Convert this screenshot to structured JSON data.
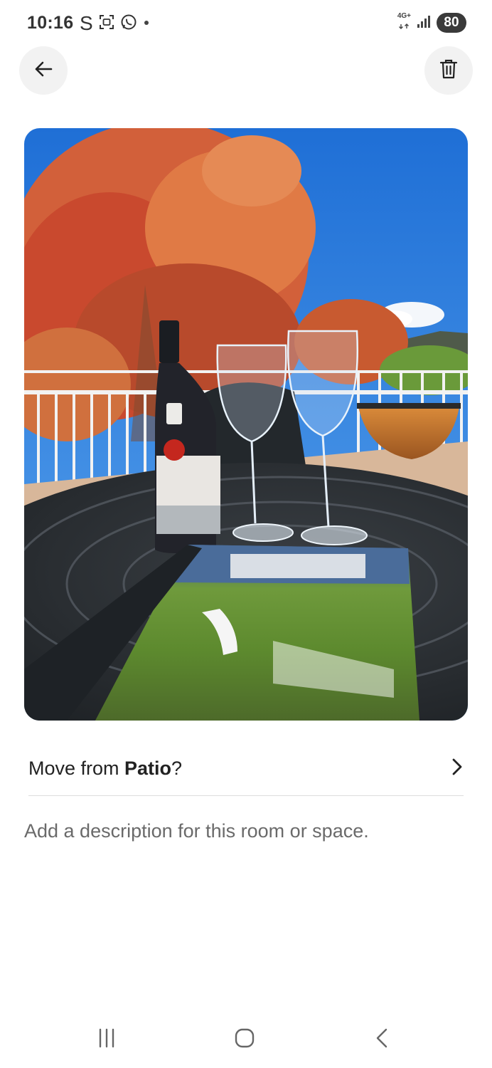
{
  "status_bar": {
    "time": "10:16",
    "carrier_glyph": "S",
    "network_label": "4G+",
    "battery": "80",
    "icons": [
      "screenshot-icon",
      "whatsapp-icon",
      "dot-icon",
      "signal-icon"
    ]
  },
  "header": {
    "back_icon": "arrow-left-icon",
    "delete_icon": "trash-icon"
  },
  "photo": {
    "subject": "wine-bottle-glasses-magazine-on-patio-table"
  },
  "move_row": {
    "prefix": "Move from ",
    "room": "Patio",
    "suffix": "?",
    "chevron_icon": "chevron-right-icon"
  },
  "description": {
    "placeholder": "Add a description for this room or space."
  },
  "nav_bar": {
    "icons": [
      "recent-apps-icon",
      "home-icon",
      "back-icon"
    ]
  },
  "colors": {
    "text": "#222222",
    "muted": "#6a6a6a",
    "button_bg": "#f2f2f2",
    "divider": "#dddddd"
  }
}
